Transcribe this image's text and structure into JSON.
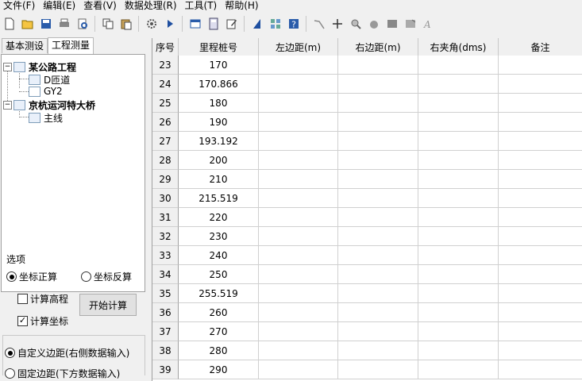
{
  "menu": [
    "文件(F)",
    "编辑(E)",
    "查看(V)",
    "数据处理(R)",
    "工具(T)",
    "帮助(H)"
  ],
  "toolbar": {
    "icons": [
      "new-file-icon",
      "open-folder-icon",
      "save-icon",
      "print-icon",
      "print-preview-icon",
      "copy-icon",
      "paste-icon",
      "settings-icon",
      "run-icon",
      "window-icon",
      "calculator-icon",
      "edit-icon",
      "vector-icon",
      "grid-icon",
      "help-icon",
      "line-icon",
      "crosshair-icon",
      "zoom-icon",
      "pan-hand-icon",
      "square-icon",
      "image-icon",
      "text-style-icon"
    ]
  },
  "tabs": [
    "基本测设",
    "工程测量"
  ],
  "tree": {
    "project1": "某公路工程",
    "p1_child1": "D匝道",
    "p1_child2": "GY2",
    "project2": "京杭运河特大桥",
    "p2_child1": "主线"
  },
  "options": {
    "title": "选项",
    "radio_forward": "坐标正算",
    "radio_inverse": "坐标反算",
    "calc_elevation": "计算高程",
    "calc_coords": "计算坐标",
    "start_button": "开始计算",
    "radio_custom": "自定义边距(右侧数据输入)",
    "radio_fixed": "固定边距(下方数据输入)"
  },
  "table": {
    "headers": [
      "序号",
      "里程桩号",
      "左边距(m)",
      "右边距(m)",
      "右夹角(dms)",
      "备注"
    ],
    "rows": [
      [
        "23",
        "170"
      ],
      [
        "24",
        "170.866"
      ],
      [
        "25",
        "180"
      ],
      [
        "26",
        "190"
      ],
      [
        "27",
        "193.192"
      ],
      [
        "28",
        "200"
      ],
      [
        "29",
        "210"
      ],
      [
        "30",
        "215.519"
      ],
      [
        "31",
        "220"
      ],
      [
        "32",
        "230"
      ],
      [
        "33",
        "240"
      ],
      [
        "34",
        "250"
      ],
      [
        "35",
        "255.519"
      ],
      [
        "36",
        "260"
      ],
      [
        "37",
        "270"
      ],
      [
        "38",
        "280"
      ],
      [
        "39",
        "290"
      ]
    ]
  }
}
